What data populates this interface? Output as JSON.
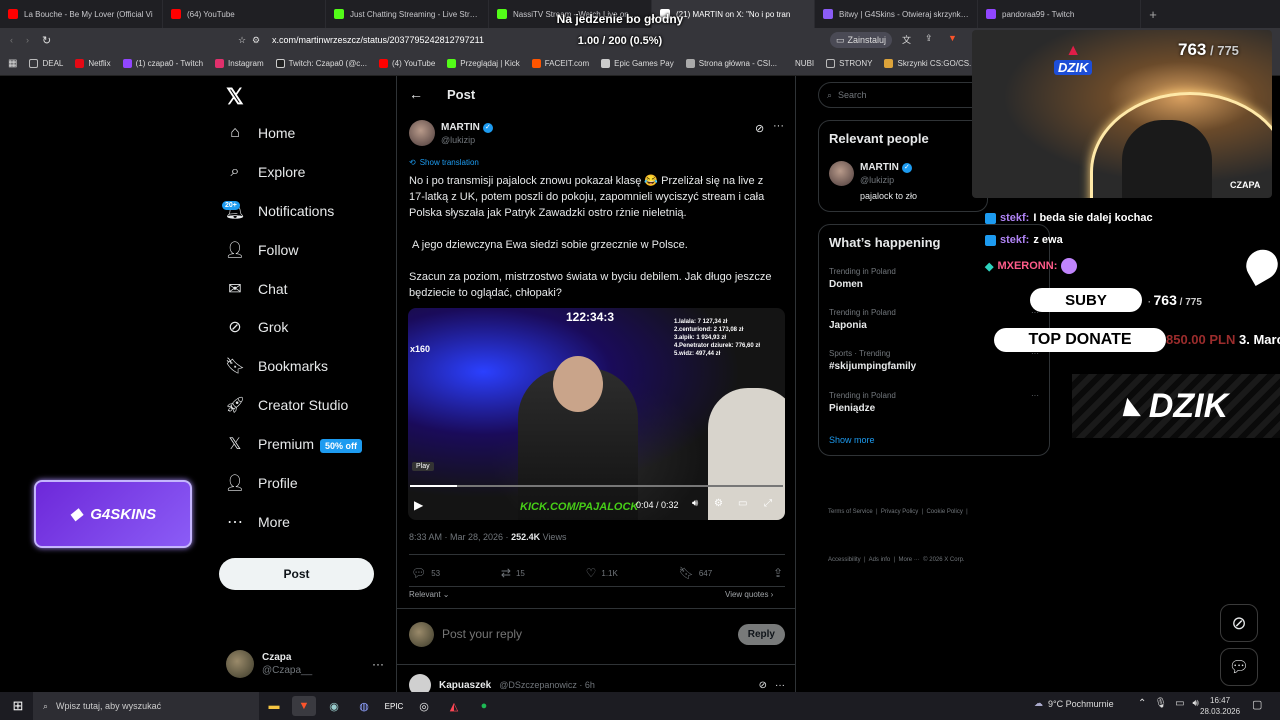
{
  "browser": {
    "tabs": [
      {
        "title": "La Bouche - Be My Lover (Official Vi",
        "color": "#ff0000"
      },
      {
        "title": "(64) YouTube",
        "color": "#ff0000"
      },
      {
        "title": "Just Chatting Streaming - Live Stream",
        "color": "#53fc18"
      },
      {
        "title": "NassiTV Stream - Watch Live on Kick",
        "color": "#53fc18"
      },
      {
        "title": "(21) MARTIN on X: \"No i po tran",
        "color": "#ffffff"
      },
      {
        "title": "Bitwy | G4Skins - Otwieraj skrzynki C",
        "color": "#8b5cf6"
      },
      {
        "title": "pandoraa99 - Twitch",
        "color": "#9146ff"
      }
    ],
    "url": "x.com/martinwrzeszcz/status/2037795242812797211",
    "install_label": "Zainstaluj",
    "bookmarks": [
      "DEAL",
      "Netflix",
      "(1) czapa0 - Twitch",
      "Instagram",
      "Twitch: Czapa0 (@c...",
      "(4) YouTube",
      "Przeglądaj | Kick",
      "FACEIT.com",
      "Epic Games Pay",
      "Strona główna - CSI...",
      "NUBI",
      "STRONY",
      "Skrzynki CS:GO/CS..."
    ]
  },
  "overlay": {
    "goal_title": "Na jedzenie bo głodny",
    "goal_progress": "1.00 / 200 (0.5%)",
    "goal_fraction": 0.005,
    "g4skins_label": "G4SKINS",
    "dzik_logo_small": "DZIK",
    "dzik_logo_big": "DZIK",
    "cam_name": "CZAPA",
    "sub_count_top": "763",
    "sub_goal_top": "775",
    "suby_label": "SUBY",
    "sub_count": "763",
    "sub_goal": "775",
    "top_donate_label": "TOP DONATE",
    "top_donate_amount": "850.00 PLN",
    "top_donate_rank": "3. Marc",
    "chat": [
      {
        "user": "stekf:",
        "msg": "I beda sie dalej kochac",
        "color": "#b084f5"
      },
      {
        "user": "stekf:",
        "msg": "z ewa",
        "color": "#b084f5"
      },
      {
        "user": "MXERONN:",
        "msg": "",
        "color": "#ff5c8a"
      }
    ]
  },
  "sidebar": {
    "items": [
      {
        "label": "Home",
        "icon": "home-icon",
        "glyph": "⌂"
      },
      {
        "label": "Explore",
        "icon": "search-icon",
        "glyph": "⌕"
      },
      {
        "label": "Notifications",
        "icon": "bell-icon",
        "glyph": "🔔︎"
      },
      {
        "label": "Follow",
        "icon": "follow-icon",
        "glyph": "👤︎"
      },
      {
        "label": "Chat",
        "icon": "mail-icon",
        "glyph": "✉"
      },
      {
        "label": "Grok",
        "icon": "grok-icon",
        "glyph": "⊘"
      },
      {
        "label": "Bookmarks",
        "icon": "bookmark-icon",
        "glyph": "🔖︎"
      },
      {
        "label": "Creator Studio",
        "icon": "rocket-icon",
        "glyph": "🚀︎"
      },
      {
        "label": "Premium",
        "icon": "x-logo-icon",
        "glyph": "𝕏"
      },
      {
        "label": "Profile",
        "icon": "profile-icon",
        "glyph": "👤︎"
      },
      {
        "label": "More",
        "icon": "more-circle-icon",
        "glyph": "⋯"
      }
    ],
    "notif_badge": "20+",
    "premium_badge": "50% off",
    "post_button": "Post",
    "account_name": "Czapa",
    "account_handle": "@Czapa__"
  },
  "post": {
    "header": "Post",
    "author_name": "MARTIN",
    "author_handle": "@lukizip",
    "show_translation": "Show translation",
    "text_p1": "No i po transmisji pajalock znowu pokazał klasę 😂 Przeliżał się na live z 17-latką z UK, potem poszli do pokoju, zapomnieli wyciszyć stream i cała Polska słyszała jak Patryk Zawadzki ostro rżnie nieletnią.",
    "text_p2": "A jego dziewczyna Ewa siedzi sobie grzecznie w Polsce.",
    "text_p3": "Szacun za poziom, mistrzostwo świata w byciu debilem. Jak długo jeszcze będziecie to oglądać, chłopaki?",
    "video": {
      "timer": "122:34:3",
      "leaderboard": [
        "1.lalala: 7 127,34 zł",
        "2.centuriond: 2 173,08 zł",
        "3.alpik: 1 934,93 zł",
        "4.Penetrator dziurek: 776,60 zł",
        "5.widz: 497,44 zł"
      ],
      "x_count": "x160",
      "watermark": "KICK.COM/PAJALOCK",
      "play_tooltip": "Play",
      "time": "0:04 / 0:32",
      "progress_fraction": 0.125
    },
    "meta_time": "8:33 AM · Mar 28, 2026 · ",
    "views_count": "252.4K",
    "views_label": " Views",
    "replies": "53",
    "reposts": "15",
    "likes": "1.1K",
    "bookmarks": "647",
    "relevant": "Relevant",
    "view_quotes": "View quotes",
    "reply_placeholder": "Post your reply",
    "reply_button": "Reply",
    "reply_name": "Kapuaszek",
    "reply_handle": "@DSzczepanowicz · 6h"
  },
  "right": {
    "search_placeholder": "Search",
    "relevant_title": "Relevant people",
    "person_name": "MARTIN",
    "person_handle": "@lukizip",
    "person_bio": "pajalock to zło",
    "happening_title": "What’s happening",
    "trends": [
      {
        "cat": "Trending in Poland",
        "name": "Domen"
      },
      {
        "cat": "Trending in Poland",
        "name": "Japonia"
      },
      {
        "cat": "Sports · Trending",
        "name": "#skijumpingfamily"
      },
      {
        "cat": "Trending in Poland",
        "name": "Pieniądze"
      }
    ],
    "show_more": "Show more",
    "footer1": "Terms of Service  |  Privacy Policy  |  Cookie Policy  |",
    "footer2": "Accessibility  |  Ads info  |  More ···  © 2026 X Corp."
  },
  "taskbar": {
    "search": "Wpisz tutaj, aby wyszukać",
    "weather": "9°C  Pochmurnie",
    "time": "16:47",
    "date": "28.03.2026"
  }
}
